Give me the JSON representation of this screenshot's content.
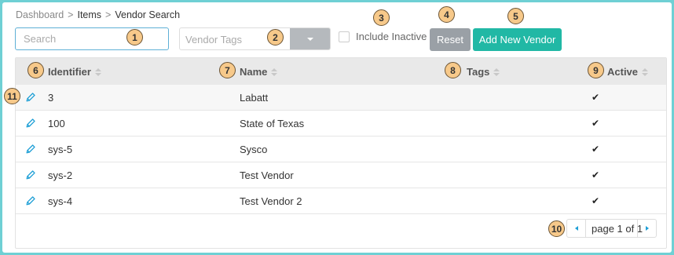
{
  "breadcrumb": {
    "root": "Dashboard",
    "separator": ">",
    "items": "Items",
    "current": "Vendor Search"
  },
  "toolbar": {
    "search_placeholder": "Search",
    "tags_placeholder": "Vendor Tags",
    "include_inactive_label": "Include Inactive",
    "reset_label": "Reset",
    "add_vendor_label": "Add New Vendor"
  },
  "table": {
    "columns": [
      "Identifier",
      "Name",
      "Tags",
      "Active"
    ],
    "rows": [
      {
        "identifier": "3",
        "name": "Labatt",
        "tags": "",
        "active": "✔"
      },
      {
        "identifier": "100",
        "name": "State of Texas",
        "tags": "",
        "active": "✔"
      },
      {
        "identifier": "sys-5",
        "name": "Sysco",
        "tags": "",
        "active": "✔"
      },
      {
        "identifier": "sys-2",
        "name": "Test Vendor",
        "tags": "",
        "active": "✔"
      },
      {
        "identifier": "sys-4",
        "name": "Test Vendor 2",
        "tags": "",
        "active": "✔"
      }
    ]
  },
  "pager": {
    "text": "page 1 of 1"
  },
  "annotations": [
    "1",
    "2",
    "3",
    "4",
    "5",
    "6",
    "7",
    "8",
    "9",
    "10",
    "11"
  ],
  "colors": {
    "accent": "#21b8a5",
    "reset": "#9aa0a6",
    "focus_border": "#5fb0d6",
    "marker": "#f7c98a",
    "background": "#6fd0d4"
  },
  "icons": [
    "edit-pencil-icon",
    "checkmark-icon",
    "sort-icon",
    "chevron-left-icon",
    "chevron-right-icon",
    "caret-down-icon"
  ]
}
